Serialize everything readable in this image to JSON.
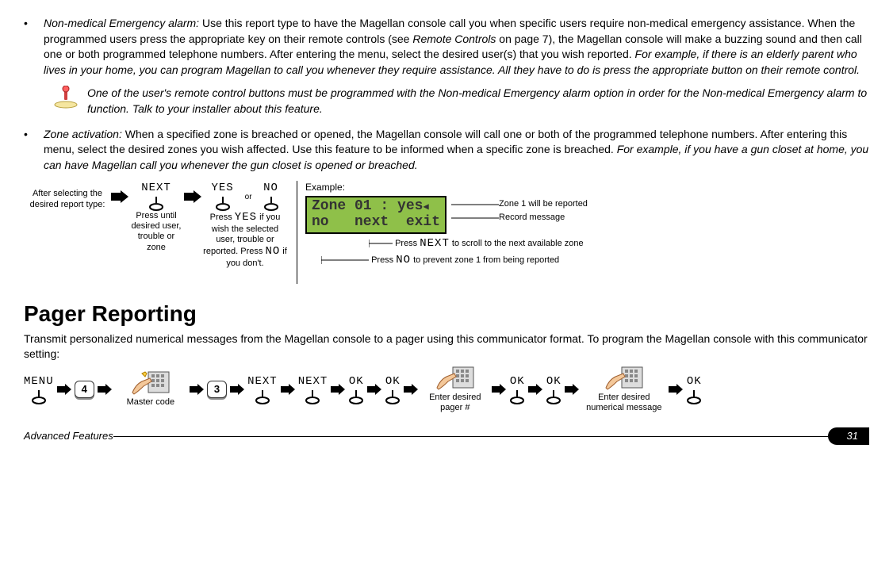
{
  "bullet1": {
    "title": "Non-medical Emergency alarm:",
    "text_a": " Use this report type to have the Magellan console call you when specific users require non-medical emergency assistance. When the programmed users press the appropriate key on their remote controls (see ",
    "ref": "Remote Controls",
    "text_b": " on page 7), the Magellan console will make a buzzing sound and then call one or both programmed telephone numbers. After entering the menu, select the desired user(s) that you wish reported. ",
    "example": "For example, if there is an elderly parent who lives in your home, you can program Magellan to call you whenever they require assistance. All they have to do is press the appropriate button on their remote control."
  },
  "note1": "One of the user's remote control buttons must be programmed with the Non-medical Emergency alarm option in order for the Non-medical Emergency alarm to function. Talk to your installer about this feature.",
  "bullet2": {
    "title": "Zone activation:",
    "text_a": " When a specified zone is breached or opened, the Magellan console will call one or both of the programmed telephone numbers. After entering this menu, select the desired zones you wish affected. Use this feature to be informed when a specific zone is breached. ",
    "example": "For example, if you have a gun closet at home, you can have Magellan call you whenever the gun closet is opened or breached."
  },
  "diag1": {
    "after_text": "After selecting the desired report type:",
    "next_label": "NEXT",
    "next_caption": "Press until desired user, trouble or zone",
    "yes_label": "YES",
    "no_label": "NO",
    "or": "or",
    "yesno_caption_a": "Press ",
    "yesno_caption_yes": "YES",
    "yesno_caption_b": " if you wish the selected user, trouble or reported. Press ",
    "yesno_caption_no": "NO",
    "yesno_caption_c": " if you don't.",
    "example_label": "Example:",
    "lcd_line1": "Zone 01 : yes",
    "lcd_line2": "no   next  exit",
    "anno1": "Zone 1 will be reported",
    "anno2": "Record message",
    "anno3_a": "Press ",
    "anno3_key": "NEXT",
    "anno3_b": " to scroll to the next available zone",
    "anno4_a": "Press ",
    "anno4_key": "NO",
    "anno4_b": " to prevent zone 1 from being reported"
  },
  "heading": "Pager Reporting",
  "pager_intro": "Transmit personalized numerical messages from the Magellan console to a pager using this communicator format. To program the Magellan console with this communicator setting:",
  "flow": {
    "menu": "MENU",
    "key4": "4",
    "master_code": "Master code",
    "key3": "3",
    "next": "NEXT",
    "ok": "OK",
    "enter_pager": "Enter desired pager #",
    "enter_msg": "Enter desired numerical message"
  },
  "footer": {
    "section": "Advanced Features",
    "page": "31"
  }
}
